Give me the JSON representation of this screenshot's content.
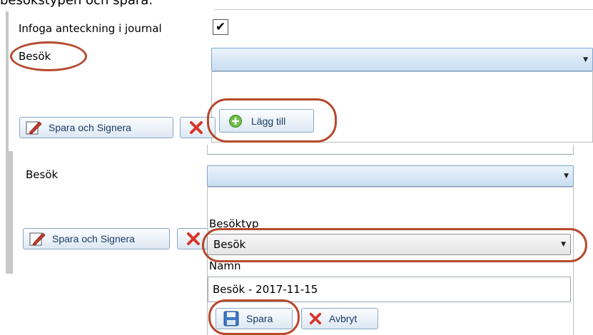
{
  "top_caption": "besökstypen och spara.",
  "upper": {
    "journal_label": "Infoga anteckning i journal",
    "journal_checked": true,
    "visit_label": "Besök",
    "save_sign_label": "Spara och Signera",
    "add_label": "Lägg till"
  },
  "lower": {
    "visit_label": "Besök",
    "save_sign_label": "Spara och Signera",
    "visit_type_label": "Besöktyp",
    "visit_type_value": "Besök",
    "name_label": "Namn",
    "name_value": "Besök - 2017-11-15",
    "save_label": "Spara",
    "cancel_label": "Avbryt"
  },
  "colors": {
    "annotation_ring": "#b5492e",
    "dropdown_border": "#7ea6cf",
    "button_text": "#1b3a66"
  },
  "icons": [
    "pencil-icon",
    "close-icon",
    "add-circle-icon",
    "save-disk-icon",
    "chevron-down-icon"
  ]
}
